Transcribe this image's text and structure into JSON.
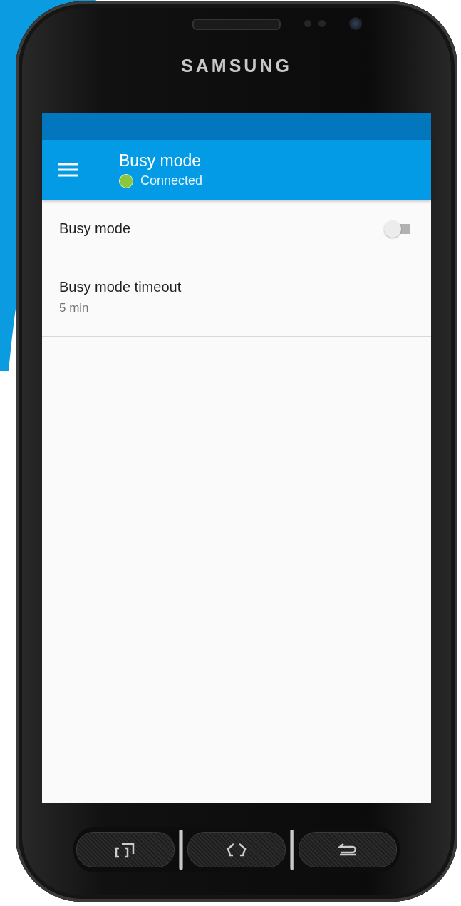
{
  "device": {
    "brand": "SAMSUNG"
  },
  "app_bar": {
    "title": "Busy mode",
    "status": {
      "label": "Connected",
      "color": "#8cc63f"
    }
  },
  "settings": [
    {
      "kind": "switch",
      "title": "Busy mode",
      "on": false
    },
    {
      "kind": "value",
      "title": "Busy mode timeout",
      "value": "5 min"
    }
  ]
}
